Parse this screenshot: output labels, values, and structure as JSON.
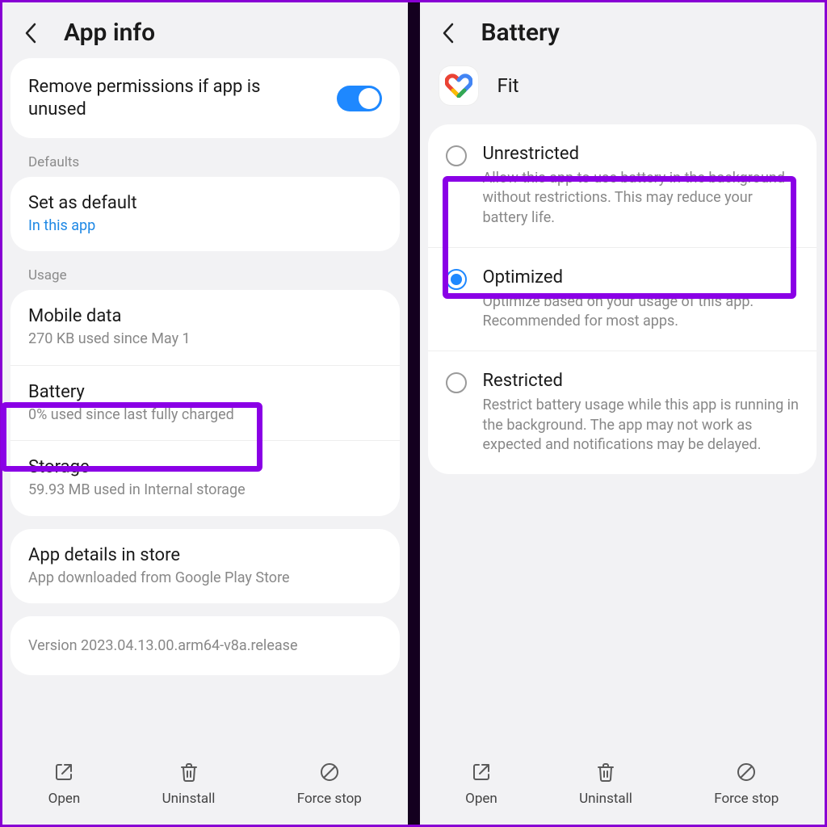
{
  "left": {
    "title": "App info",
    "remove_permissions": {
      "label": "Remove permissions if app is unused",
      "on": true
    },
    "section_defaults": "Defaults",
    "set_default": {
      "title": "Set as default",
      "sub": "In this app"
    },
    "section_usage": "Usage",
    "mobile_data": {
      "title": "Mobile data",
      "sub": "270 KB used since May 1"
    },
    "battery": {
      "title": "Battery",
      "sub": "0% used since last fully charged"
    },
    "storage": {
      "title": "Storage",
      "sub": "59.93 MB used in Internal storage"
    },
    "app_details": {
      "title": "App details in store",
      "sub": "App downloaded from Google Play Store"
    },
    "version": "Version 2023.04.13.00.arm64-v8a.release"
  },
  "right": {
    "title": "Battery",
    "app_name": "Fit",
    "options": {
      "unrestricted": {
        "title": "Unrestricted",
        "desc": "Allow this app to use battery in the background without restrictions. This may reduce your battery life.",
        "selected": false
      },
      "optimized": {
        "title": "Optimized",
        "desc": "Optimize based on your usage of this app. Recommended for most apps.",
        "selected": true
      },
      "restricted": {
        "title": "Restricted",
        "desc": "Restrict battery usage while this app is running in the background. The app may not work as expected and notifications may be delayed.",
        "selected": false
      }
    }
  },
  "bottom": {
    "open": "Open",
    "uninstall": "Uninstall",
    "force_stop": "Force stop"
  }
}
